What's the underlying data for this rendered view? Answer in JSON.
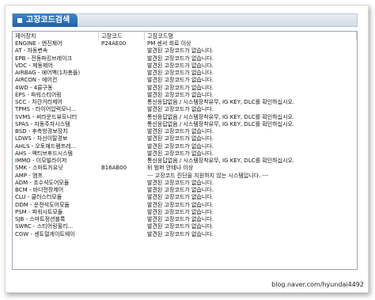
{
  "window": {
    "title": "고장코드검색"
  },
  "table": {
    "columns": [
      "제어장치",
      "고장코드",
      "고장코드명"
    ],
    "rows": [
      [
        "ENGINE - 엔진제어",
        "P24AE00",
        "PM 센서 회로 이상"
      ],
      [
        "AT - 자동변속",
        "",
        "발견된 고장코드가 없습니다."
      ],
      [
        "EPB - 전동파킹브레이크",
        "",
        "발견된 고장코드가 없습니다."
      ],
      [
        "VDC - 제동제어",
        "",
        "발견된 고장코드가 없습니다."
      ],
      [
        "AIRBAG - 에어백(1차충돌)",
        "",
        "발견된 고장코드가 없습니다."
      ],
      [
        "AIRCON - 에어컨",
        "",
        "발견된 고장코드가 없습니다."
      ],
      [
        "4WD - 4륜구동",
        "",
        "발견된 고장코드가 없습니다."
      ],
      [
        "EPS - 파워스티어링",
        "",
        "발견된 고장코드가 없습니다."
      ],
      [
        "SCC - 차간거리제어",
        "",
        "통신응답없음 / 시스템장착유무, IG KEY, DLC를 확인하십시오."
      ],
      [
        "TPMS - 타이어압력모니...",
        "",
        "발견된 고장코드가 없습니다."
      ],
      [
        "SVMS - 써라운드뷰모니터",
        "",
        "통신응답없음 / 시스템장착유무, IG KEY, DLC를 확인하십시오."
      ],
      [
        "SPAS - 자동주차시스템",
        "",
        "통신응답없음 / 시스템장착유무, IG KEY, DLC를 확인하십시오."
      ],
      [
        "BSD - 후측방경보장치",
        "",
        "발견된 고장코드가 없습니다."
      ],
      [
        "LDWS - 차선이탈경보",
        "",
        "발견된 고장코드가 없습니다."
      ],
      [
        "AHLS - 오토헤드램프레...",
        "",
        "발견된 고장코드가 없습니다."
      ],
      [
        "AHS - 액티브후드시스템",
        "",
        "발견된 고장코드가 없습니다."
      ],
      [
        "IMMO - 이모빌라이저",
        "",
        "통신응답없음 / 시스템장착유무, IG KEY, DLC를 확인하십시오."
      ],
      [
        "SMK - 스마트키유닛",
        "B16AB00",
        "뒤 범퍼 안테나 이상"
      ],
      [
        "AMP - 앰프",
        "",
        "--- 고장코드 진단을 지원하지 않는 시스템입니다. ---"
      ],
      [
        "ADM - 조수석도어모듈",
        "",
        "발견된 고장코드가 없습니다."
      ],
      [
        "BCM - 바디전장제어",
        "",
        "발견된 고장코드가 없습니다."
      ],
      [
        "CLU - 클러스터모듈",
        "",
        "발견된 고장코드가 없습니다."
      ],
      [
        "DDM - 운전석도어모듈",
        "",
        "발견된 고장코드가 없습니다."
      ],
      [
        "PSM - 파워시트모듈",
        "",
        "발견된 고장코드가 없습니다."
      ],
      [
        "SJB - 스마트정션블록",
        "",
        "발견된 고장코드가 없습니다."
      ],
      [
        "SWRC - 스티어링휠리...",
        "",
        "발견된 고장코드가 없습니다."
      ],
      [
        "CGW - 센트럴게이트웨이",
        "",
        "발견된 고장코드가 없습니다."
      ]
    ]
  },
  "watermark": "blog.naver.com/hyundai4492"
}
